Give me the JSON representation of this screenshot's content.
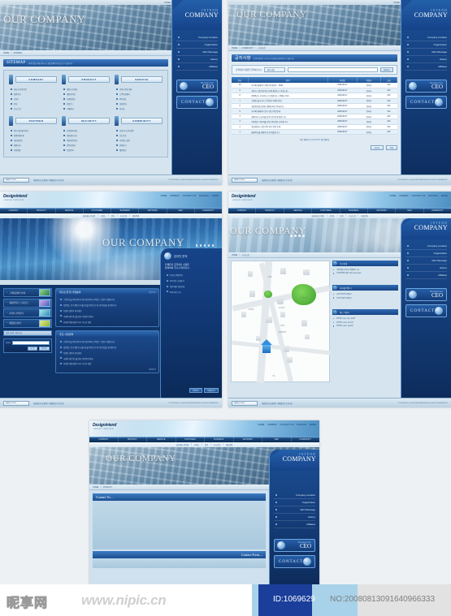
{
  "meta": {
    "brand_logo": "Designintend",
    "brand_logo_sub": "DESIGN TEMPLATE",
    "sidebar_brand_top": "INTEND",
    "sidebar_brand_main": "COMPANY"
  },
  "utility_links": [
    "HOME",
    "SITEMAP",
    "CONTACT US",
    "ENGLISH",
    "ADMIN"
  ],
  "top_links": [
    "HOME",
    "SITEMAP",
    "CONTACT US",
    "ENGLISH",
    "ADMIN"
  ],
  "global_nav": [
    "COMPANY",
    "PRODUCT",
    "SERVICE",
    "CUSTOMER",
    "BUSINESS",
    "NETWORK",
    "R&D",
    "COMMUNITY"
  ],
  "sub_nav": [
    "회사개요 인사말",
    "조직도",
    "연혁",
    "오시는길",
    "제휴문의"
  ],
  "side_menu": [
    {
      "label": "Company Location"
    },
    {
      "label": "Organization"
    },
    {
      "label": "CEO Message"
    },
    {
      "label": "History"
    },
    {
      "label": "Affiliates"
    }
  ],
  "side_buttons": {
    "ceo_small": "Message From",
    "ceo_large": "CEO",
    "contact": "CONTACT"
  },
  "footer": {
    "family_site_label": "FAMILY SITE",
    "links": "개인정보보호정책 | 이메일무단수집거부",
    "copyright": "COPYRIGHT(C) 2008 DESIGNINTEND ALL RIGHTS RESERVED."
  },
  "panel1": {
    "name": "sitemap-page",
    "breadcrumb": [
      "HOME",
      "SITEMAP"
    ],
    "hero_title": "OUR COMPANY",
    "page_title": "SITEMAP",
    "page_sub": "사이트맵을 통해 원하시는 정보를 빠르게 찾으실 수 있습니다.",
    "columns": [
      {
        "title": "COMPANY",
        "items": [
          "회사소개 인사말",
          "경영이념",
          "조직도",
          "연혁",
          "오시는길"
        ]
      },
      {
        "title": "PRODUCT",
        "items": [
          "제품소개 개요",
          "제품라인업",
          "신제품정보",
          "카탈로그",
          "구매안내"
        ]
      },
      {
        "title": "SERVICE",
        "items": [
          "서비스안내 개요",
          "고객지원센터",
          "A/S신청",
          "설치안내",
          "자료실"
        ]
      },
      {
        "title": "PARTNER",
        "items": [
          "파트너쉽 제휴안내",
          "협력업체등록",
          "대리점안내",
          "해외지사",
          "사업제안"
        ]
      },
      {
        "title": "SECURITY",
        "items": [
          "보안정책 개요",
          "개인정보보호",
          "이용약관동의",
          "인증서안내",
          "보안문의"
        ]
      },
      {
        "title": "COMMUNITY",
        "items": [
          "커뮤니티 공지사항",
          "보도자료",
          "자주묻는질문",
          "문의하기",
          "채용정보"
        ]
      }
    ]
  },
  "panel2": {
    "name": "board-list-page",
    "breadcrumb": [
      "HOME",
      "COMMUNITY",
      "공지사항"
    ],
    "hero_title": "OUR COMPANY",
    "page_title": "공지사항",
    "page_sub": "회사의 새로운 소식과 공지사항을 확인하실 수 있습니다.",
    "search": {
      "label": "검색하실 내용을 입력하십시오",
      "select_value": "제목+내용",
      "input_value": "",
      "button": "검색하기"
    },
    "table": {
      "headers": [
        "번호",
        "제 목",
        "작성일",
        "작성자",
        "조회"
      ],
      "rows": [
        {
          "no": "10",
          "subject": "당사의 홈페이지 개편 안내말씀...",
          "date": "2008-08-07",
          "writer": "관리자",
          "hits": "100",
          "new": true
        },
        {
          "no": "9",
          "subject": "하반기 신입사원 정기공채 채용공고 안내드립...",
          "date": "2008-08-07",
          "writer": "관리자",
          "hits": "100",
          "new": false
        },
        {
          "no": "8",
          "subject": "2008년도 추석연휴 근무일정 및 고객센터 운영...",
          "date": "2008-08-07",
          "writer": "관리자",
          "hits": "100",
          "new": false
        },
        {
          "no": "7",
          "subject": "신제품 출시기념 고객감사 이벤트안내",
          "date": "2008-08-07",
          "writer": "관리자",
          "hits": "100",
          "new": false
        },
        {
          "no": "6",
          "subject": "개인정보취급방침 개정에 따른 안내공지 ...",
          "date": "2008-08-07",
          "writer": "관리자",
          "hits": "100",
          "new": false
        },
        {
          "no": "5",
          "subject": "당사의 홈페이지 임시 점검 작업안내",
          "date": "2008-08-07",
          "writer": "관리자",
          "hits": "100",
          "new": false
        },
        {
          "no": "4",
          "subject": "해외지사 신규개설 관련 업무안내 말씀드립...",
          "date": "2008-08-07",
          "writer": "관리자",
          "hits": "100",
          "new": false
        },
        {
          "no": "3",
          "subject": "연말정산 서류제출 관련 안내사항 공지합니다",
          "date": "2008-08-07",
          "writer": "관리자",
          "hits": "100",
          "new": false
        },
        {
          "no": "2",
          "subject": "품질경영시스템 인증 취득 알림 안내",
          "date": "2008-08-07",
          "writer": "관리자",
          "hits": "100",
          "new": false
        },
        {
          "no": "1",
          "subject": "홈페이지를 새롭게 오픈하였습니다",
          "date": "2008-08-07",
          "writer": "관리자",
          "hits": "100",
          "new": false
        }
      ],
      "pager": "이전 페이지   [ 1 ] 2 3 4 5   다음 페이지",
      "buttons": [
        "글쓰기",
        "목록"
      ]
    }
  },
  "panel3": {
    "name": "company-intro-dark-page",
    "hero_title": "OUR COMPANY",
    "side_items": [
      {
        "num": "1",
        "label": "고객지원센터 안내"
      },
      {
        "num": "2",
        "label": "제품카탈로그 다운로드"
      },
      {
        "num": "3",
        "label": "온라인 견적문의"
      },
      {
        "num": "4",
        "label": "채용정보안내"
      }
    ],
    "family_select": "관련 사이트 바로가기",
    "login": {
      "label": "아이디",
      "buttons": [
        "로그인",
        "회원가입"
      ]
    },
    "box1": {
      "title": "회사소개 및 사업분야",
      "more": "자세히보기",
      "items": [
        "고객만족을 최우선의 가치로 생각하며 신뢰받는 기업이 되겠습니다.",
        "끊임없는 연구개발과 기술혁신을 바탕으로 최고의 품질을 제공합니다.",
        "투명한 경영과 윤리경영",
        "국내외 네트워크를 통한 사업영역 확대",
        "친환경 제품개발과 지속 가능한 성장"
      ]
    },
    "box2": {
      "title": "주요 사업영역",
      "more": "자세히보기",
      "items": [
        "고객만족을 최우선의 가치로 생각하며 신뢰받는 기업이 되겠습니다.",
        "끊임없는 연구개발과 기술혁신을 바탕으로 최고의 품질을 제공합니다.",
        "투명한 경영과 윤리경영",
        "국내외 네트워크를 통한 사업영역 확대",
        "친환경 제품개발과 지속 가능한 성장"
      ]
    },
    "right_panel": {
      "title": "온라인 문의",
      "headline1": "언제든지 궁금하신 사항은",
      "headline2": "문의하여 주시기 바랍니다",
      "items": [
        "온라인 견적문의",
        "A/S 접수 신청하기",
        "제휴/제안 상담신청",
        "FAQ 바로가기"
      ],
      "buttons": [
        "문의하기",
        "자세히보기"
      ]
    }
  },
  "panel4": {
    "name": "location-map-page",
    "breadcrumb": [
      "HOME",
      "오시는길"
    ],
    "hero_title": "OUR COMPANY",
    "map_labels": [
      "시청역",
      "중앙공원",
      "본사사옥",
      "대학교",
      "종합운동장",
      "시민회관",
      "국도"
    ],
    "info_blocks": [
      {
        "title": "주소안내",
        "items": [
          "서울특별시 강남구 테헤란로 123",
          "디자인인텐드빌딩 5층 (우)135-080"
        ]
      },
      {
        "title": "지하철 이용시",
        "items": [
          "2호선 강남역 4번출구",
          "7호선 학동역 3번출구"
        ]
      },
      {
        "title": "버스 이용시",
        "items": [
          "간선버스 140, 146, 360번",
          "지선버스 3412, 4412번",
          "광역버스 9407, 9409번"
        ]
      }
    ]
  },
  "panel5": {
    "name": "contact-form-page",
    "breadcrumb": [
      "HOME",
      "CONTACT"
    ],
    "hero_title": "OUR COMPANY",
    "section_top": "Contact Us....",
    "section_bottom": "Contact Form...."
  },
  "watermark": {
    "cn_logo": "昵享网",
    "url": "www.nipic.cn",
    "id": "ID:1069629",
    "no": "NO:20080813091640966333"
  }
}
